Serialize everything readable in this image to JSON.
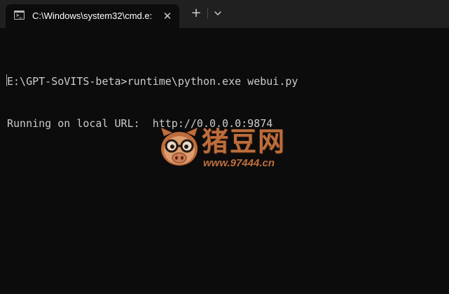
{
  "tab": {
    "title": "C:\\Windows\\system32\\cmd.e:",
    "icon_prompt": ">_",
    "close_glyph": "✕",
    "icon": "cmd-icon"
  },
  "toolbar": {
    "new_tab_glyph": "+",
    "dropdown_icon": "chevron-down-icon"
  },
  "terminal": {
    "lines": [
      "E:\\GPT-SoVITS-beta>runtime\\python.exe webui.py",
      "Running on local URL:  http://0.0.0.0:9874"
    ],
    "text_color": "#cccccc",
    "background": "#0c0c0c"
  },
  "watermark": {
    "title": "猪豆网",
    "url": "www.97444.cn",
    "color": "#c8733f",
    "icon": "pig-mascot-icon"
  }
}
